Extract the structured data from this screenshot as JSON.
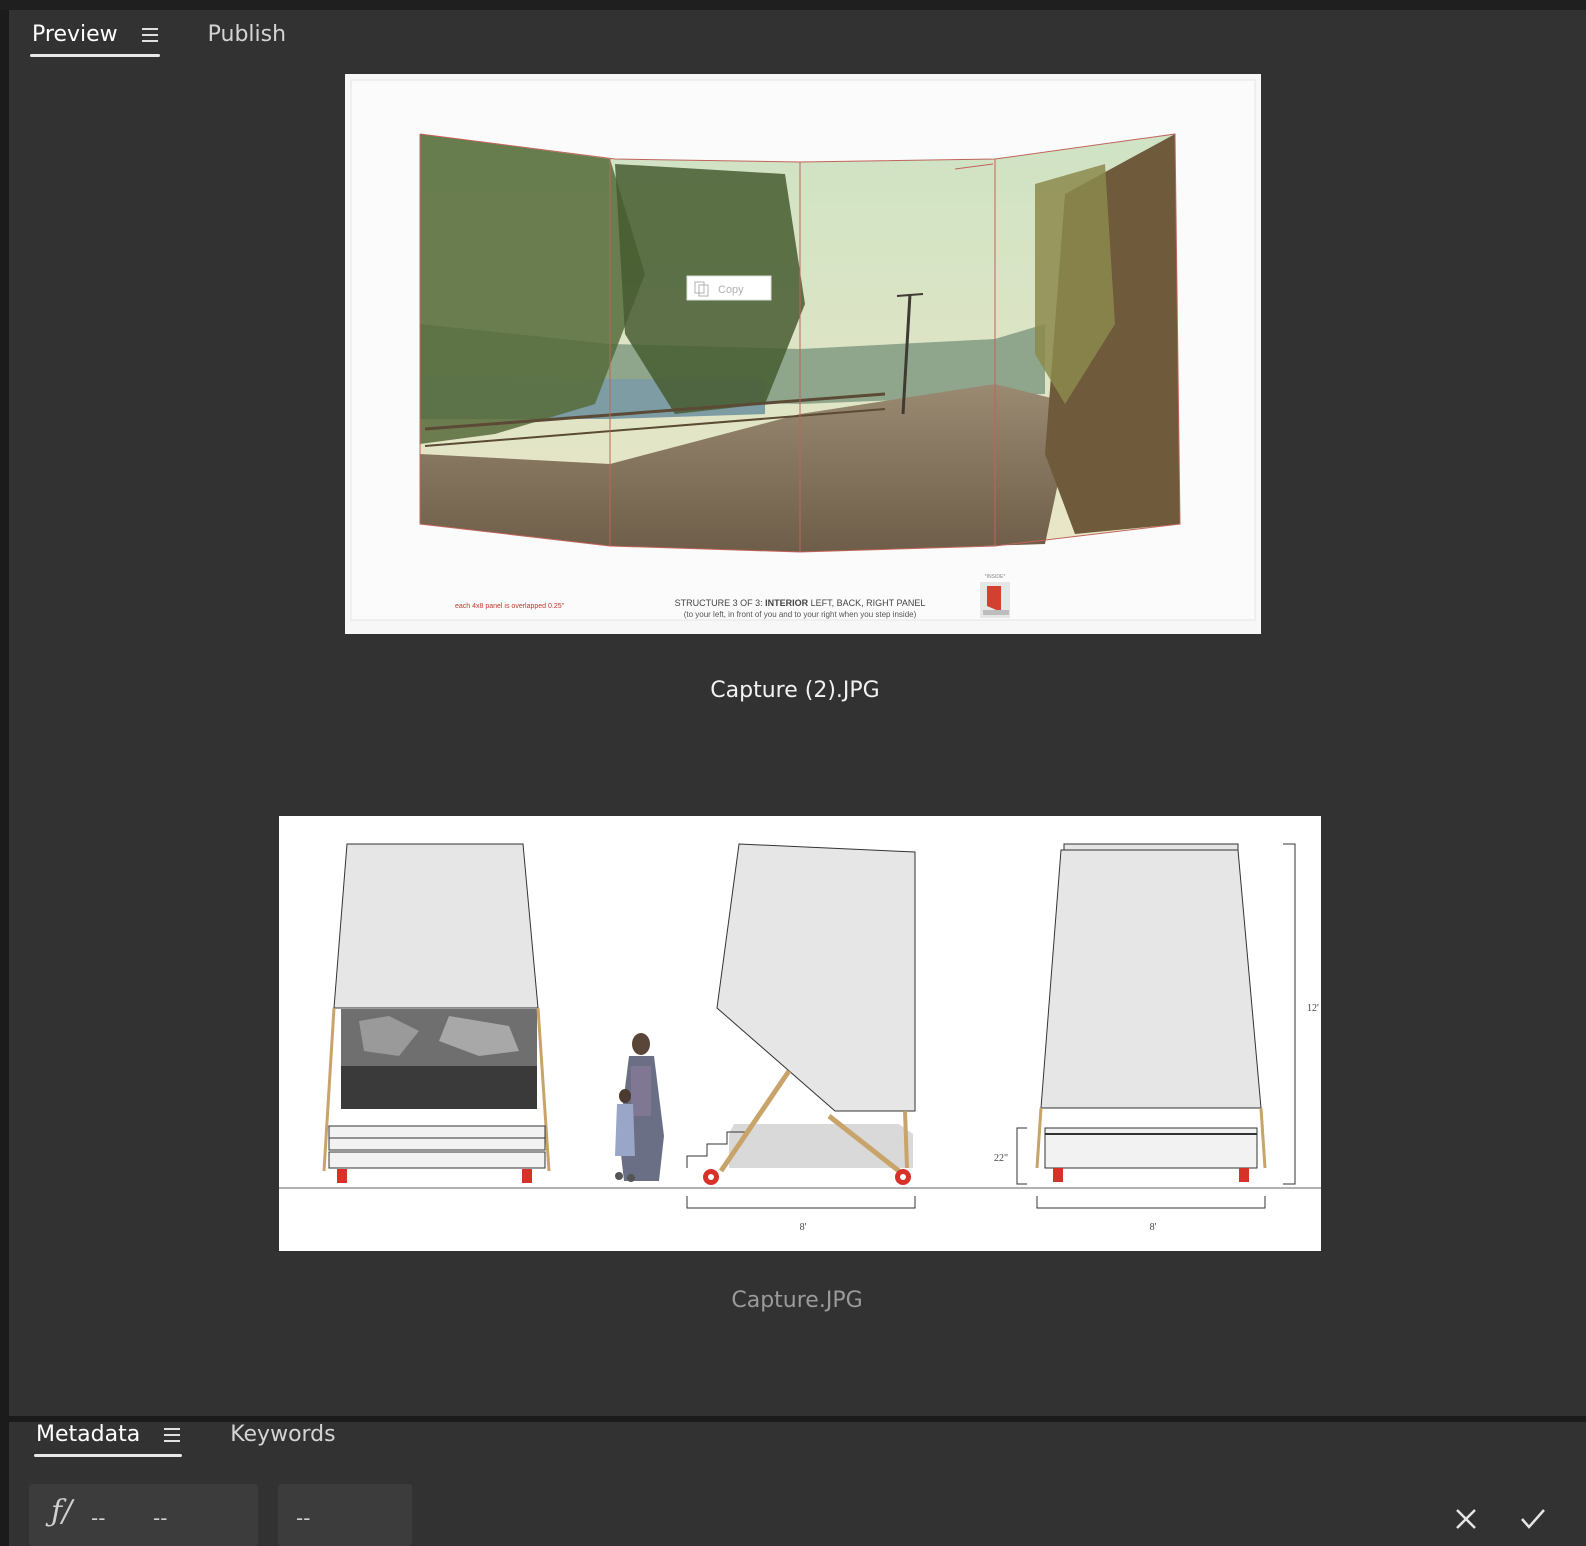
{
  "preview_tabs": {
    "preview_label": "Preview",
    "publish_label": "Publish"
  },
  "images": [
    {
      "filename": "Capture (2).JPG",
      "copy_tooltip": "Copy",
      "footer_left": "each 4x8 panel is overlapped 0.25\"",
      "footer_title_prefix": "STRUCTURE 3 OF 3: ",
      "footer_title_bold": "INTERIOR",
      "footer_title_suffix": " LEFT, BACK, RIGHT PANEL",
      "footer_sub": "(to your left, in front of you and to your right when you step inside)",
      "inside_label": "*INSIDE*"
    },
    {
      "filename": "Capture.JPG",
      "dim_height": "12'",
      "dim_base": "22\"",
      "dim_width_1": "8'",
      "dim_width_2": "8'"
    }
  ],
  "metadata_tabs": {
    "metadata_label": "Metadata",
    "keywords_label": "Keywords"
  },
  "metadata_fields": {
    "aperture_symbol": "ƒ/",
    "aperture_value": "--",
    "shutter_value": "--",
    "iso_value": "--"
  },
  "colors": {
    "panel_bg": "#323232",
    "accent_red": "#c0392b",
    "wood": "#c9a46a"
  }
}
